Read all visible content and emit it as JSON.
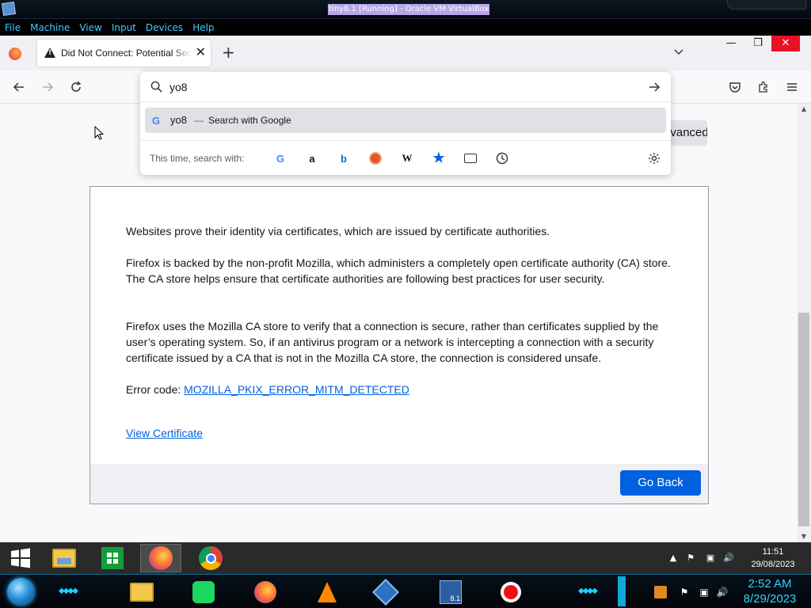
{
  "vbox": {
    "title": "tiny8.1 [Running] - Oracle VM VirtualBox",
    "menu": [
      "File",
      "Machine",
      "View",
      "Input",
      "Devices",
      "Help"
    ]
  },
  "browser": {
    "tab_title": "Did Not Connect: Potential Security Issue",
    "newtab_label": "+",
    "urlbar": {
      "value": "yo8",
      "placeholder": ""
    },
    "suggestion": {
      "query": "yo8",
      "dash": "—",
      "action": "Search with Google"
    },
    "engines_label": "This time, search with:",
    "engines": [
      "google-icon",
      "amazon-icon",
      "bing-icon",
      "duckduckgo-icon",
      "wikipedia-icon",
      "bookmarks-icon",
      "tabs-icon",
      "history-icon"
    ]
  },
  "page": {
    "advanced_label": "Advanced…",
    "para1": "Websites prove their identity via certificates, which are issued by certificate authorities.",
    "para2": "Firefox is backed by the non-profit Mozilla, which administers a completely open certificate authority (CA) store. The CA store helps ensure that certificate authorities are following best practices for user security.",
    "para3": "Firefox uses the Mozilla CA store to verify that a connection is secure, rather than certificates supplied by the user’s operating system. So, if an antivirus program or a network is intercepting a connection with a security certificate issued by a CA that is not in the Mozilla CA store, the connection is considered unsafe.",
    "error_label": "Error code:",
    "error_code": "MOZILLA_PKIX_ERROR_MITM_DETECTED",
    "view_certificate": "View Certificate",
    "go_back": "Go Back"
  },
  "guest_taskbar": {
    "time": "11:51",
    "date": "29/08/2023"
  },
  "host_taskbar": {
    "time": "2:52 AM",
    "date": "8/29/2023",
    "vbox_badge": "8.1"
  },
  "colors": {
    "accent": "#0061e0",
    "link": "#0061e0",
    "close_red": "#e81123",
    "host_cyan": "#2fd3ff"
  }
}
